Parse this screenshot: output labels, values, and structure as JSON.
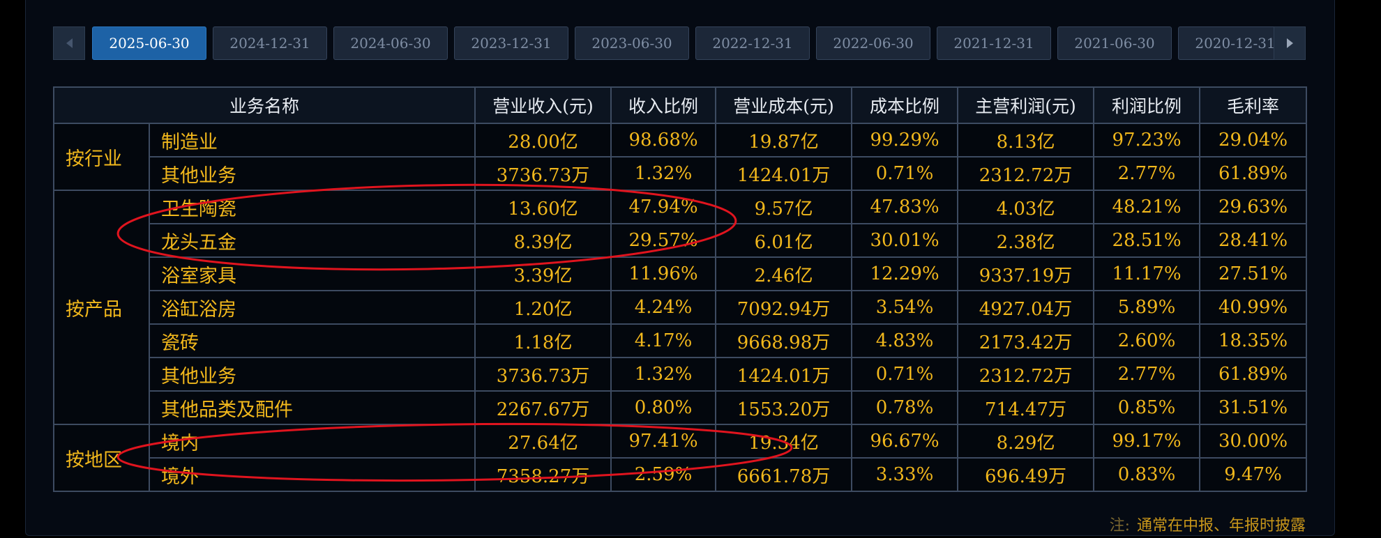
{
  "tabs": {
    "items": [
      "2025-06-30",
      "2024-12-31",
      "2024-06-30",
      "2023-12-31",
      "2023-06-30",
      "2022-12-31",
      "2022-06-30",
      "2021-12-31",
      "2021-06-30",
      "2020-12-31"
    ],
    "active": "2025-06-30"
  },
  "table": {
    "headers": [
      "业务名称",
      "营业收入(元)",
      "收入比例",
      "营业成本(元)",
      "成本比例",
      "主营利润(元)",
      "利润比例",
      "毛利率"
    ],
    "groups": [
      {
        "label": "按行业",
        "rows": [
          [
            "制造业",
            "28.00亿",
            "98.68%",
            "19.87亿",
            "99.29%",
            "8.13亿",
            "97.23%",
            "29.04%"
          ],
          [
            "其他业务",
            "3736.73万",
            "1.32%",
            "1424.01万",
            "0.71%",
            "2312.72万",
            "2.77%",
            "61.89%"
          ]
        ]
      },
      {
        "label": "按产品",
        "rows": [
          [
            "卫生陶瓷",
            "13.60亿",
            "47.94%",
            "9.57亿",
            "47.83%",
            "4.03亿",
            "48.21%",
            "29.63%"
          ],
          [
            "龙头五金",
            "8.39亿",
            "29.57%",
            "6.01亿",
            "30.01%",
            "2.38亿",
            "28.51%",
            "28.41%"
          ],
          [
            "浴室家具",
            "3.39亿",
            "11.96%",
            "2.46亿",
            "12.29%",
            "9337.19万",
            "11.17%",
            "27.51%"
          ],
          [
            "浴缸浴房",
            "1.20亿",
            "4.24%",
            "7092.94万",
            "3.54%",
            "4927.04万",
            "5.89%",
            "40.99%"
          ],
          [
            "瓷砖",
            "1.18亿",
            "4.17%",
            "9668.98万",
            "4.83%",
            "2173.42万",
            "2.60%",
            "18.35%"
          ],
          [
            "其他业务",
            "3736.73万",
            "1.32%",
            "1424.01万",
            "0.71%",
            "2312.72万",
            "2.77%",
            "61.89%"
          ],
          [
            "其他品类及配件",
            "2267.67万",
            "0.80%",
            "1553.20万",
            "0.78%",
            "714.47万",
            "0.85%",
            "31.51%"
          ]
        ]
      },
      {
        "label": "按地区",
        "rows": [
          [
            "境内",
            "27.64亿",
            "97.41%",
            "19.34亿",
            "96.67%",
            "8.29亿",
            "99.17%",
            "30.00%"
          ],
          [
            "境外",
            "7358.27万",
            "2.59%",
            "6661.78万",
            "3.33%",
            "696.49万",
            "0.83%",
            "9.47%"
          ]
        ]
      }
    ]
  },
  "note": {
    "label": "注:",
    "text": "通常在中报、年报时披露"
  },
  "colors": {
    "background": "#050a13",
    "value_text": "#f2b81c",
    "header_text": "#e8ecf2",
    "active_tab": "#1d62a6",
    "annotation": "#e0141e"
  }
}
